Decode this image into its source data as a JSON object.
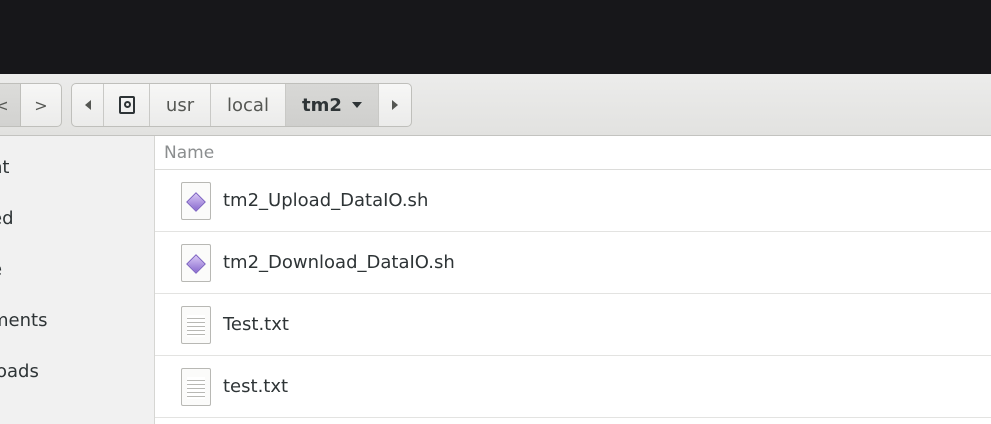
{
  "navigation": {
    "back_glyph": "<",
    "forward_glyph": ">",
    "icons": {
      "scroll_left": "triangle-left-icon",
      "root": "drive-icon",
      "dropdown": "triangle-down-icon",
      "scroll_right": "triangle-right-icon"
    }
  },
  "pathbar": {
    "segments": [
      "usr",
      "local",
      "tm2"
    ],
    "current": "tm2"
  },
  "sidebar": {
    "items": [
      {
        "label": "nt"
      },
      {
        "label": "ed"
      },
      {
        "label": "e"
      },
      {
        "label": "ments"
      },
      {
        "label": "loads"
      }
    ]
  },
  "file_list": {
    "column_header": "Name",
    "files": [
      {
        "name": "tm2_Upload_DataIO.sh",
        "icon": "script-file-icon"
      },
      {
        "name": "tm2_Download_DataIO.sh",
        "icon": "script-file-icon"
      },
      {
        "name": "Test.txt",
        "icon": "text-file-icon"
      },
      {
        "name": "test.txt",
        "icon": "text-file-icon"
      }
    ]
  },
  "colors": {
    "topbar": "#17171a",
    "headerbar": "#e8e8e7",
    "sidebar": "#f1f1f1",
    "text": "#2e3436",
    "header_text": "#8b8e8f"
  }
}
